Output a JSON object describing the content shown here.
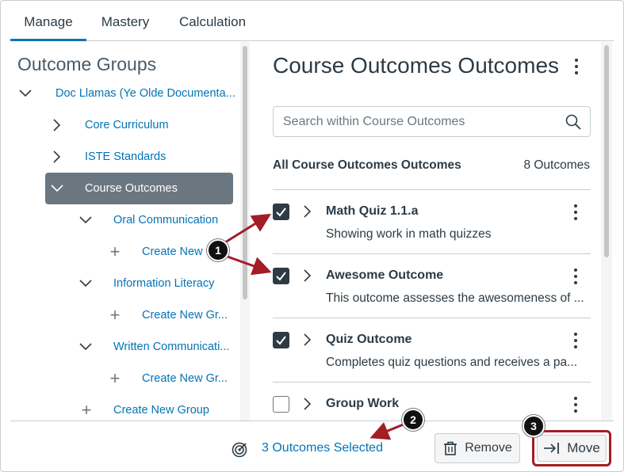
{
  "tabs": [
    {
      "label": "Manage",
      "active": true
    },
    {
      "label": "Mastery",
      "active": false
    },
    {
      "label": "Calculation",
      "active": false
    }
  ],
  "left": {
    "title": "Outcome Groups",
    "tree": [
      {
        "label": "Doc Llamas (Ye Olde Documenta...",
        "icon": "chevron-down-icon"
      },
      {
        "label": "Core Curriculum",
        "icon": "chevron-right-icon"
      },
      {
        "label": "ISTE Standards",
        "icon": "chevron-right-icon"
      },
      {
        "label": "Course Outcomes",
        "icon": "chevron-down-icon",
        "selected": true
      },
      {
        "label": "Oral Communication",
        "icon": "chevron-down-icon"
      },
      {
        "label": "Create New G",
        "icon": "plus-icon"
      },
      {
        "label": "Information Literacy",
        "icon": "chevron-down-icon"
      },
      {
        "label": "Create New Gr...",
        "icon": "plus-icon"
      },
      {
        "label": "Written Communicati...",
        "icon": "chevron-down-icon"
      },
      {
        "label": "Create New Gr...",
        "icon": "plus-icon"
      },
      {
        "label": "Create New Group",
        "icon": "plus-icon"
      }
    ]
  },
  "right": {
    "title": "Course Outcomes Outcomes",
    "search_placeholder": "Search within Course Outcomes",
    "list_heading": "All Course Outcomes Outcomes",
    "count": "8 Outcomes",
    "outcomes": [
      {
        "name": "Math Quiz 1.1.a",
        "description": "Showing work in math quizzes",
        "checked": true
      },
      {
        "name": "Awesome Outcome",
        "description": "This outcome assesses the awesomeness of ...",
        "checked": true
      },
      {
        "name": "Quiz Outcome",
        "description": "Completes quiz questions and receives a pa...",
        "checked": true
      },
      {
        "name": "Group Work",
        "description": "",
        "checked": false
      }
    ]
  },
  "footer": {
    "selected_text": "3 Outcomes Selected",
    "remove_label": "Remove",
    "move_label": "Move"
  },
  "callouts": [
    "1",
    "2",
    "3"
  ],
  "colors": {
    "link": "#0374b5",
    "text": "#2d3b45",
    "selected_bg": "#6b7780",
    "annotation": "#a31d24"
  }
}
